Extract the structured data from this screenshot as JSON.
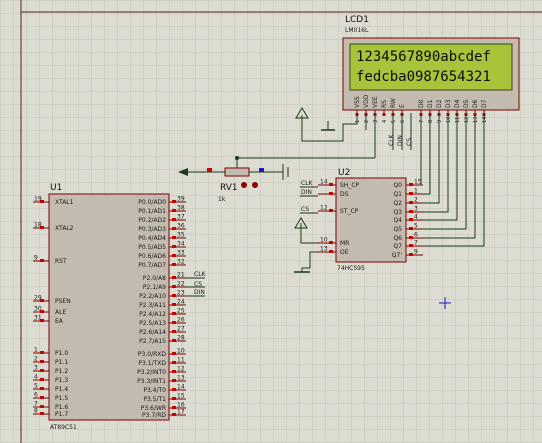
{
  "colors": {
    "background": "#dcdcd2",
    "grid": "#c4c4b8",
    "chip_body": "#c4bbb0",
    "chip_border": "#7a0000",
    "lcd_screen": "#a8c43a",
    "wire": "#1a3a1a",
    "pin_red": "#cc0000",
    "pin_blue": "#1a1acc"
  },
  "lcd": {
    "ref": "LCD1",
    "model": "LM016L",
    "line1": "1234567890abcdef",
    "line2": "fedcba0987654321",
    "pins": [
      "VSS",
      "VDD",
      "VEE",
      "RS",
      "RW",
      "E",
      "D0",
      "D1",
      "D2",
      "D3",
      "D4",
      "D5",
      "D6",
      "D7"
    ],
    "pin_numbers": [
      "1",
      "2",
      "3",
      "4",
      "5",
      "6",
      "7",
      "8",
      "9",
      "10",
      "11",
      "12",
      "13",
      "14"
    ]
  },
  "u1": {
    "ref": "U1",
    "model": "AT89C51",
    "left_pins": [
      {
        "num": "19",
        "name": "XTAL1"
      },
      {
        "num": "18",
        "name": "XTAL2"
      },
      {
        "num": "9",
        "name": "RST"
      },
      {
        "num": "29",
        "name": "PSEN"
      },
      {
        "num": "30",
        "name": "ALE"
      },
      {
        "num": "31",
        "name": "EA"
      },
      {
        "num": "1",
        "name": "P1.0"
      },
      {
        "num": "2",
        "name": "P1.1"
      },
      {
        "num": "3",
        "name": "P1.2"
      },
      {
        "num": "4",
        "name": "P1.3"
      },
      {
        "num": "5",
        "name": "P1.4"
      },
      {
        "num": "6",
        "name": "P1.5"
      },
      {
        "num": "7",
        "name": "P1.6"
      },
      {
        "num": "8",
        "name": "P1.7"
      }
    ],
    "right_pins": [
      {
        "num": "39",
        "name": "P0.0/AD0"
      },
      {
        "num": "38",
        "name": "P0.1/AD1"
      },
      {
        "num": "37",
        "name": "P0.2/AD2"
      },
      {
        "num": "36",
        "name": "P0.3/AD3"
      },
      {
        "num": "35",
        "name": "P0.4/AD4"
      },
      {
        "num": "34",
        "name": "P0.5/AD5"
      },
      {
        "num": "33",
        "name": "P0.6/AD6"
      },
      {
        "num": "32",
        "name": "P0.7/AD7"
      },
      {
        "num": "21",
        "name": "P2.0/A8"
      },
      {
        "num": "22",
        "name": "P2.1/A9"
      },
      {
        "num": "23",
        "name": "P2.2/A10"
      },
      {
        "num": "24",
        "name": "P2.3/A11"
      },
      {
        "num": "25",
        "name": "P2.4/A12"
      },
      {
        "num": "26",
        "name": "P2.5/A13"
      },
      {
        "num": "27",
        "name": "P2.6/A14"
      },
      {
        "num": "28",
        "name": "P2.7/A15"
      },
      {
        "num": "10",
        "name": "P3.0/RXD"
      },
      {
        "num": "11",
        "name": "P3.1/TXD"
      },
      {
        "num": "12",
        "name": "P3.2/INT0"
      },
      {
        "num": "13",
        "name": "P3.3/INT1"
      },
      {
        "num": "14",
        "name": "P3.4/T0"
      },
      {
        "num": "15",
        "name": "P3.5/T1"
      },
      {
        "num": "16",
        "name": "P3.6/WR"
      },
      {
        "num": "17",
        "name": "P3.7/RD"
      }
    ]
  },
  "u2": {
    "ref": "U2",
    "model": "74HC595",
    "left_pins": [
      {
        "num": "14",
        "name": "SH_CP",
        "net": "CLK"
      },
      {
        "num": "",
        "name": "DS",
        "net": "DIN"
      },
      {
        "num": "12",
        "name": "ST_CP",
        "net": "CS"
      },
      {
        "num": "10",
        "name": "MR",
        "net": ""
      },
      {
        "num": "13",
        "name": "OE",
        "net": ""
      }
    ],
    "right_pins": [
      {
        "num": "15",
        "name": "Q0"
      },
      {
        "num": "1",
        "name": "Q1"
      },
      {
        "num": "2",
        "name": "Q2"
      },
      {
        "num": "3",
        "name": "Q3"
      },
      {
        "num": "4",
        "name": "Q4"
      },
      {
        "num": "5",
        "name": "Q5"
      },
      {
        "num": "6",
        "name": "Q6"
      },
      {
        "num": "7",
        "name": "Q7"
      },
      {
        "num": "9",
        "name": "Q7'"
      }
    ]
  },
  "rv1": {
    "ref": "RV1",
    "value": "1k"
  },
  "net_labels": {
    "u1_clk": "CLK",
    "u1_cs": "CS",
    "u1_din": "DIN",
    "u2_clk": "CLK",
    "u2_din": "DIN",
    "u2_cs": "CS",
    "lcd_clk": "CLK",
    "lcd_din": "DIN",
    "lcd_cs": "CS"
  }
}
